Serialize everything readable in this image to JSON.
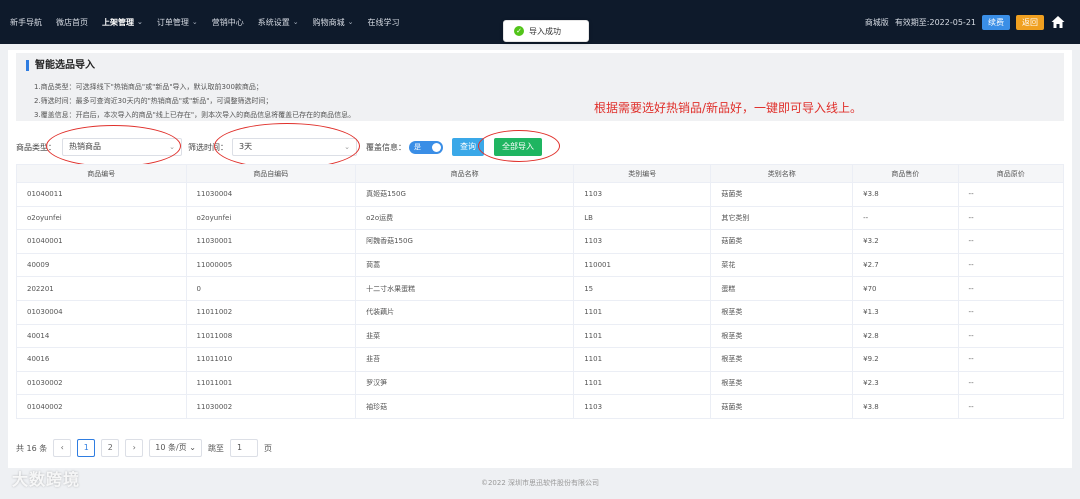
{
  "nav": {
    "items": [
      {
        "label": "新手导航",
        "chevron": false,
        "active": false
      },
      {
        "label": "微店首页",
        "chevron": false,
        "active": false
      },
      {
        "label": "上架管理",
        "chevron": true,
        "active": true
      },
      {
        "label": "订单管理",
        "chevron": true,
        "active": false
      },
      {
        "label": "营销中心",
        "chevron": false,
        "active": false
      },
      {
        "label": "系统设置",
        "chevron": true,
        "active": false
      },
      {
        "label": "购物商城",
        "chevron": true,
        "active": false
      },
      {
        "label": "在线学习",
        "chevron": false,
        "active": false
      }
    ],
    "edition": "商城版",
    "validity": "有效期至:2022-05-21",
    "renew_label": "续费",
    "back_label": "返回",
    "home_icon": "home-icon"
  },
  "toast": {
    "text": "导入成功",
    "icon": "check-circle-icon"
  },
  "intro": {
    "title": "智能选品导入",
    "lines": [
      "1.商品类型：可选择线下\"热销商品\"或\"新品\"导入，默认取前300款商品；",
      "2.筛选时间：最多可查询近30天内的\"热销商品\"或\"新品\"，可调整筛选时间；",
      "3.覆盖信息：开启后，本次导入的商品\"线上已存在\"，则本次导入的商品信息将覆盖已存在的商品信息。"
    ]
  },
  "annotation": "根据需要选好热销品/新品好，一键即可导入线上。",
  "filters": {
    "type_label": "商品类型：",
    "type_value": "热销商品",
    "time_label": "筛选时间：",
    "time_value": "3天",
    "cover_label": "覆盖信息：",
    "cover_toggle": "是",
    "query_label": "查询",
    "import_label": "全部导入"
  },
  "table": {
    "headers": [
      "商品编号",
      "商品自编码",
      "商品名称",
      "类别编号",
      "类别名称",
      "商品售价",
      "商品原价"
    ],
    "rows": [
      [
        "01040011",
        "11030004",
        "真姬菇150G",
        "1103",
        "菇菌类",
        "¥3.8",
        "--"
      ],
      [
        "o2oyunfei",
        "o2oyunfei",
        "o2o运费",
        "LB",
        "其它类别",
        "--",
        "--"
      ],
      [
        "01040001",
        "11030001",
        "阿魏香菇150G",
        "1103",
        "菇菌类",
        "¥3.2",
        "--"
      ],
      [
        "40009",
        "11000005",
        "茼蒿",
        "110001",
        "菜花",
        "¥2.7",
        "--"
      ],
      [
        "202201",
        "0",
        "十二寸水果蛋糕",
        "15",
        "蛋糕",
        "¥70",
        "--"
      ],
      [
        "01030004",
        "11011002",
        "代装藕片",
        "1101",
        "根茎类",
        "¥1.3",
        "--"
      ],
      [
        "40014",
        "11011008",
        "韭菜",
        "1101",
        "根茎类",
        "¥2.8",
        "--"
      ],
      [
        "40016",
        "11011010",
        "韭苔",
        "1101",
        "根茎类",
        "¥9.2",
        "--"
      ],
      [
        "01030002",
        "11011001",
        "罗汉笋",
        "1101",
        "根茎类",
        "¥2.3",
        "--"
      ],
      [
        "01040002",
        "11030002",
        "袖珍菇",
        "1103",
        "菇菌类",
        "¥3.8",
        "--"
      ]
    ]
  },
  "pager": {
    "total": "共 16 条",
    "prev_icon": "chevron-left-icon",
    "pages": [
      "1",
      "2"
    ],
    "next_icon": "chevron-right-icon",
    "page_size": "10 条/页",
    "goto_label": "跳至",
    "goto_value": "1",
    "page_suffix": "页"
  },
  "footer": "©2022 深圳市思迅软件股份有限公司",
  "watermark": "大数跨境"
}
